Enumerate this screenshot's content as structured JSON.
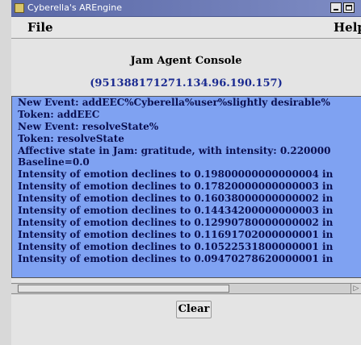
{
  "window": {
    "title": "Cyberella's AREngine"
  },
  "menu": {
    "file": "File",
    "help": "Help"
  },
  "console": {
    "title": "Jam Agent Console",
    "id": "(951388171271.134.96.190.157)",
    "log": [
      "New Event: addEEC%Cyberella%user%slightly desirable%",
      "Token: addEEC",
      "New Event: resolveState%",
      "Token: resolveState",
      "Affective state in Jam: gratitude, with intensity: 0.220000",
      "Baseline=0.0",
      "Intensity of emotion declines to 0.19800000000000004 in",
      "Intensity of emotion declines to 0.17820000000000003 in",
      "Intensity of emotion declines to 0.16038000000000002 in",
      "Intensity of emotion declines to 0.14434200000000003 in",
      "Intensity of emotion declines to 0.12990780000000002 in",
      "Intensity of emotion declines to 0.11691702000000001 in",
      "Intensity of emotion declines to 0.10522531800000001 in",
      "Intensity of emotion declines to 0.09470278620000001 in"
    ],
    "clear_label": "Clear"
  }
}
